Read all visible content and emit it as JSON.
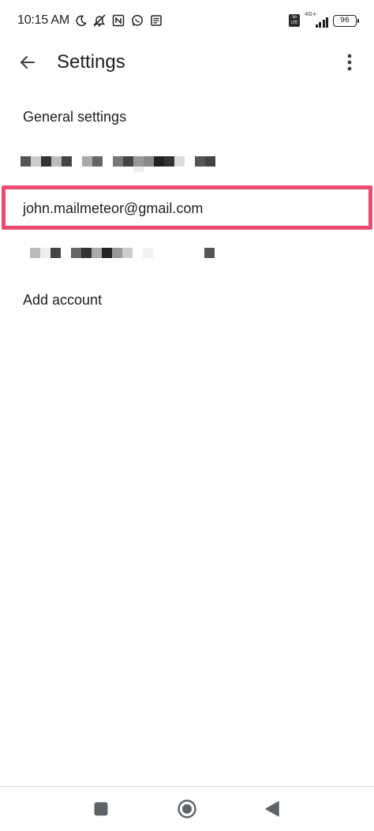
{
  "status_bar": {
    "time": "10:15 AM",
    "left_icons": [
      "moon-icon",
      "mute-icon",
      "nfc-icon",
      "whatsapp-icon",
      "news-icon"
    ],
    "volte": "Vo LTE",
    "network": "4G+",
    "battery": "96"
  },
  "app_bar": {
    "title": "Settings",
    "back_icon": "arrow-back-icon",
    "menu_icon": "more-vert-icon"
  },
  "list": {
    "general_settings": "General settings",
    "account_highlighted": "john.mailmeteor@gmail.com",
    "add_account": "Add account",
    "highlight_color": "#ed4a73"
  },
  "nav_bar": {
    "recents_icon": "square-icon",
    "home_icon": "circle-icon",
    "back_icon": "triangle-back-icon"
  }
}
